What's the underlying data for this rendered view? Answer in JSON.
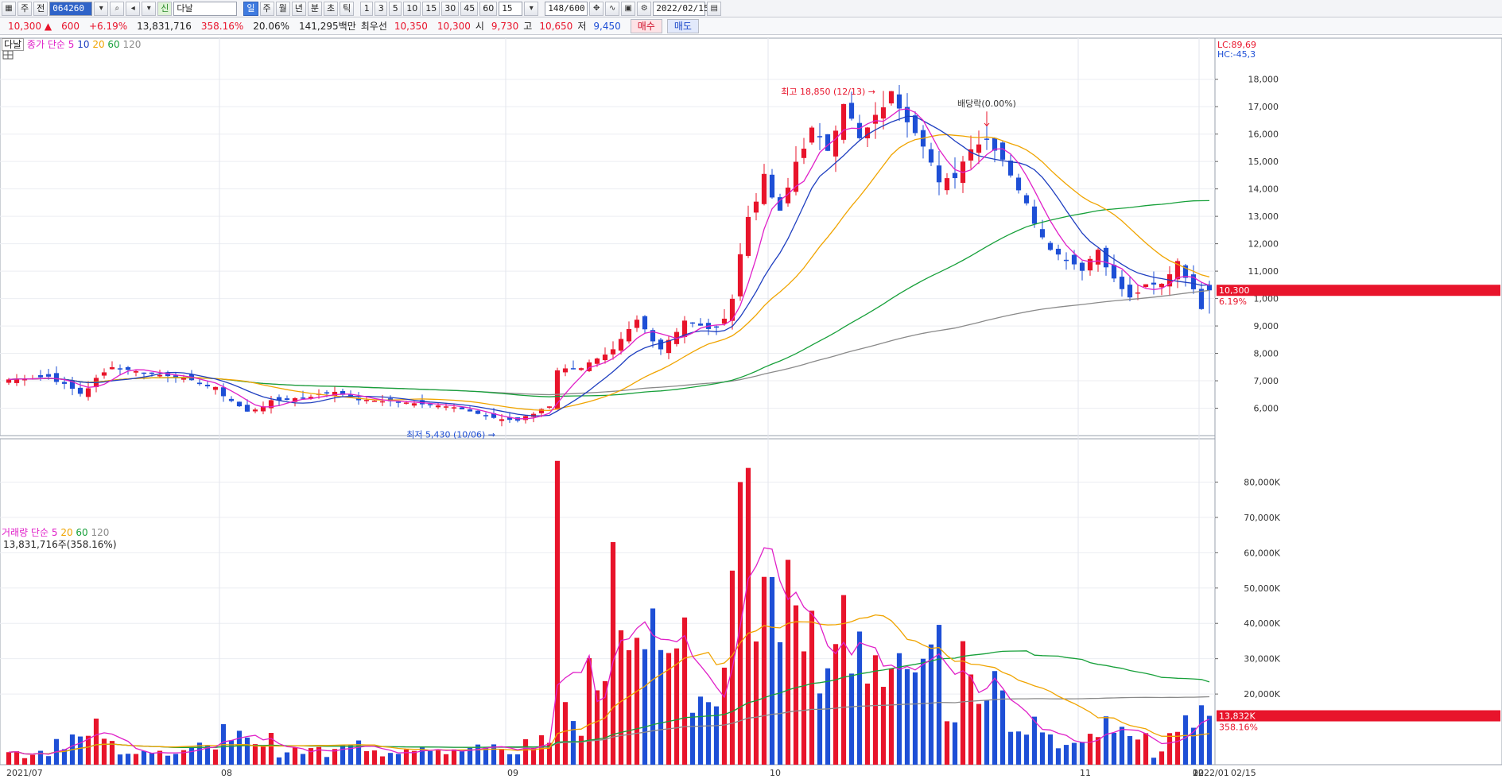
{
  "toolbar": {
    "market_type": "주",
    "market_sub": "전",
    "stock_code": "064260",
    "credit_badge": "신",
    "stock_name": "다날",
    "periods": [
      "일",
      "주",
      "월",
      "년",
      "분",
      "초",
      "틱"
    ],
    "active_period": "일",
    "intervals": [
      "1",
      "3",
      "5",
      "10",
      "15",
      "30",
      "45",
      "60"
    ],
    "interval_value": "15",
    "count_display": "148/600",
    "date": "2022/02/15"
  },
  "quote": {
    "price": "10,300",
    "arrow": "▲",
    "change": "600",
    "change_pct": "+6.19%",
    "volume": "13,831,716",
    "volume_ratio": "358.16%",
    "turnover": "20.06%",
    "amount": "141,295백만",
    "best_ask_label": "최우선",
    "best_ask": "10,350",
    "best_bid": "10,300",
    "open_label": "시",
    "open": "9,730",
    "high_label": "고",
    "high": "10,650",
    "low_label": "저",
    "low": "9,450",
    "buy_label": "매수",
    "sell_label": "매도"
  },
  "price_legend": {
    "title": "다날",
    "ma_label": "종가 단순",
    "periods": [
      "5",
      "10",
      "20",
      "60",
      "120"
    ]
  },
  "volume_legend": {
    "title": "거래량 단순",
    "periods": [
      "5",
      "20",
      "60",
      "120"
    ],
    "info": "13,831,716주(358.16%)"
  },
  "annotations": {
    "high": "최고 18,850 (12/13)",
    "low": "최저 5,430 (10/06)",
    "dividend": "배당락(0.00%)",
    "lc": "LC:89,69",
    "hc": "HC:-45,3",
    "last_price": "10,300",
    "last_pct": "6.19%",
    "last_volume": "13,832K",
    "last_volume_pct": "358.16%"
  },
  "colors": {
    "up": "#e8142b",
    "down": "#1e4fd6",
    "ma5": "#e020c8",
    "ma10": "#1f3fc0",
    "ma20": "#f0a400",
    "ma60": "#17a03a",
    "ma120": "#8a8a8a"
  },
  "chart_data": {
    "type": "candlestick",
    "x_ticks": [
      "2021/07",
      "08",
      "09",
      "10",
      "11",
      "12",
      "2022/01",
      "02",
      "02/15"
    ],
    "price_ticks": [
      6000,
      7000,
      8000,
      9000,
      10000,
      11000,
      12000,
      13000,
      14000,
      15000,
      16000,
      17000,
      18000
    ],
    "price_tick_labels": [
      "6,000",
      "7,000",
      "8,000",
      "9,000",
      "1,000",
      "11,000",
      "12,000",
      "13,000",
      "14,000",
      "15,000",
      "16,000",
      "17,000",
      "18,000"
    ],
    "price_range": [
      5000,
      19500
    ],
    "volume_ticks": [
      20000,
      30000,
      40000,
      50000,
      60000,
      70000,
      80000
    ],
    "volume_tick_labels": [
      "20,000K",
      "30,000K",
      "40,000K",
      "50,000K",
      "60,000K",
      "70,000K",
      "80,000K"
    ],
    "volume_range_k": [
      0,
      90000
    ],
    "waypoints_close": [
      [
        0,
        7050
      ],
      [
        5,
        7150
      ],
      [
        9,
        6550
      ],
      [
        13,
        7500
      ],
      [
        18,
        7250
      ],
      [
        22,
        7100
      ],
      [
        26,
        6700
      ],
      [
        30,
        5850
      ],
      [
        33,
        6250
      ],
      [
        37,
        6400
      ],
      [
        41,
        6600
      ],
      [
        44,
        6300
      ],
      [
        48,
        6250
      ],
      [
        52,
        6150
      ],
      [
        56,
        6050
      ],
      [
        60,
        5700
      ],
      [
        62,
        5600
      ],
      [
        64,
        5550
      ],
      [
        66,
        5800
      ],
      [
        68,
        6150
      ],
      [
        69,
        7400
      ],
      [
        72,
        7500
      ],
      [
        76,
        8000
      ],
      [
        79,
        9200
      ],
      [
        82,
        8200
      ],
      [
        85,
        9200
      ],
      [
        89,
        8800
      ],
      [
        91,
        10100
      ],
      [
        93,
        13000
      ],
      [
        95,
        14400
      ],
      [
        97,
        13000
      ],
      [
        99,
        15000
      ],
      [
        101,
        16200
      ],
      [
        103,
        15500
      ],
      [
        105,
        17200
      ],
      [
        107,
        15800
      ],
      [
        109,
        16600
      ],
      [
        111,
        17500
      ],
      [
        113,
        16500
      ],
      [
        115,
        15700
      ],
      [
        117,
        14200
      ],
      [
        119,
        14500
      ],
      [
        121,
        15500
      ],
      [
        123,
        15800
      ],
      [
        125,
        15100
      ],
      [
        127,
        14000
      ],
      [
        129,
        12800
      ],
      [
        131,
        11800
      ],
      [
        133,
        11400
      ],
      [
        135,
        11100
      ],
      [
        137,
        11800
      ],
      [
        139,
        10700
      ],
      [
        141,
        10000
      ],
      [
        143,
        10500
      ],
      [
        145,
        10500
      ],
      [
        147,
        11400
      ],
      [
        149,
        10300
      ],
      [
        150,
        9700
      ],
      [
        151,
        10300
      ]
    ],
    "ma_last": {
      "ma20": 10700,
      "ma60": 13400,
      "ma120": 10100
    }
  }
}
